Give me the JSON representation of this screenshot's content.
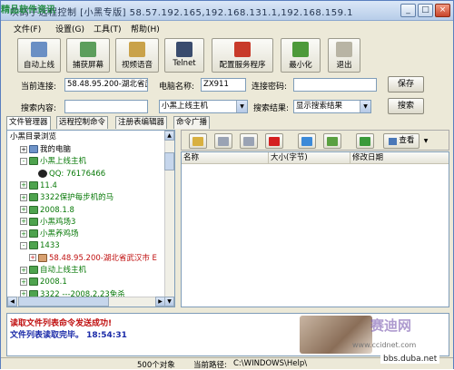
{
  "title_bar": {
    "title": "灰鸽子远程控制 [小黑专版]  58.57.192.165,192.168.131.1,192.168.159.1",
    "controls": [
      "minimize",
      "maximize",
      "close"
    ]
  },
  "watermark_top": "精品软件资讯",
  "menu": [
    "文件(F)",
    "设置(G)",
    "工具(T)",
    "帮助(H)"
  ],
  "toolbar": [
    {
      "label": "自动上线",
      "icon": "auto-online-icon"
    },
    {
      "label": "捕获屏幕",
      "icon": "capture-screen-icon"
    },
    {
      "label": "视频语音",
      "icon": "video-voice-icon"
    },
    {
      "label": "Telnet",
      "icon": "telnet-icon"
    },
    {
      "label": "配置服务程序",
      "icon": "config-service-icon"
    },
    {
      "label": "最小化",
      "icon": "minimize-icon"
    },
    {
      "label": "退出",
      "icon": "exit-icon"
    }
  ],
  "connection": {
    "current_label": "当前连接:",
    "current_value": "58.48.95.200-湖北省武",
    "computer_label": "电脑名称:",
    "computer_value": "ZX911",
    "password_label": "连接密码:",
    "password_value": "",
    "save_button": "保存"
  },
  "search": {
    "content_label": "搜索内容:",
    "content_value": "",
    "scope_value": "小黑上线主机",
    "results_label": "搜索结果:",
    "results_value": "显示搜索结果",
    "search_button": "搜索"
  },
  "tabs": [
    "文件管理器",
    "远程控制命令",
    "注册表编辑器",
    "命令广播"
  ],
  "tree": {
    "root": "小黑目录浏览",
    "items": [
      {
        "label": "我的电脑",
        "icon": "computer-icon",
        "indent": 1,
        "expander": "+"
      },
      {
        "label": "小黑上线主机",
        "icon": "host-icon",
        "indent": 1,
        "expander": "-",
        "color": "#0a7a0a"
      },
      {
        "label": "QQ: 76176466",
        "icon": "qq-icon",
        "indent": 2,
        "expander": "",
        "color": "#0a7a0a"
      },
      {
        "label": "11.4",
        "icon": "host-icon",
        "indent": 1,
        "expander": "+",
        "color": "#0a7a0a"
      },
      {
        "label": "3322保护每步机的马",
        "icon": "host-icon",
        "indent": 1,
        "expander": "+",
        "color": "#0a7a0a"
      },
      {
        "label": "2008.1.8",
        "icon": "host-icon",
        "indent": 1,
        "expander": "+",
        "color": "#0a7a0a"
      },
      {
        "label": "小黑鸡场3",
        "icon": "host-icon",
        "indent": 1,
        "expander": "+",
        "color": "#0a7a0a"
      },
      {
        "label": "小黑养鸡场",
        "icon": "host-icon",
        "indent": 1,
        "expander": "+",
        "color": "#0a7a0a"
      },
      {
        "label": "1433",
        "icon": "host-icon",
        "indent": 1,
        "expander": "-",
        "color": "#0a7a0a"
      },
      {
        "label": "58.48.95.200-湖北省武汉市 E",
        "icon": "user-avatar-icon",
        "indent": 2,
        "expander": "+",
        "color": "#c01010"
      },
      {
        "label": "自动上线主机",
        "icon": "host-icon",
        "indent": 1,
        "expander": "+",
        "color": "#0a7a0a"
      },
      {
        "label": "2008.1",
        "icon": "host-icon",
        "indent": 1,
        "expander": "+",
        "color": "#0a7a0a"
      },
      {
        "label": "3322 ---2008.2.23免杀",
        "icon": "host-icon",
        "indent": 1,
        "expander": "+",
        "color": "#0a7a0a"
      }
    ]
  },
  "file_toolbar": [
    {
      "name": "up-folder-icon",
      "color": "#d8b040"
    },
    {
      "name": "copy-icon",
      "color": "#9aa3b4"
    },
    {
      "name": "paste-icon",
      "color": "#9aa3b4"
    },
    {
      "name": "delete-icon",
      "color": "#d42020"
    },
    {
      "name": "new-folder-icon",
      "color": "#3c8ad8"
    },
    {
      "name": "rename-icon",
      "color": "#5aa040"
    },
    {
      "name": "refresh-icon",
      "color": "#3a9a3a"
    },
    {
      "name": "view-icon",
      "color": "#4a78b8"
    }
  ],
  "view_button": "查看",
  "file_columns": [
    "名称",
    "大小(字节)",
    "修改日期"
  ],
  "log": {
    "line1": "读取文件列表命令发送成功!",
    "line2": "文件列表读取完毕。 18:54:31",
    "watermark_cn": "赛迪网",
    "watermark_url": "www.ccidnet.com"
  },
  "status": {
    "objects": "500个对象",
    "path_label": "当前路径:",
    "path_value": "C:\\WINDOWS\\Help\\"
  },
  "watermark_bbs": "bbs.duba.net",
  "colors": {
    "accent_red": "#d42020",
    "tree_green": "#0a7a0a",
    "log_red": "#c01010",
    "log_blue": "#1a2aa8"
  }
}
